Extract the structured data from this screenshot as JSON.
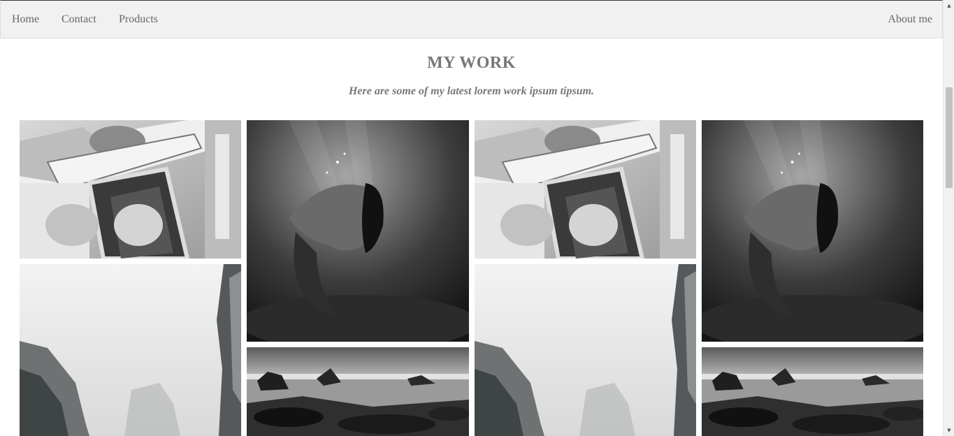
{
  "nav": {
    "home": "Home",
    "contact": "Contact",
    "products": "Products",
    "about": "About me"
  },
  "header": {
    "title": "MY WORK",
    "subtitle": "Here are some of my latest lorem work ipsum tipsum."
  },
  "gallery": {
    "photos": [
      {
        "subject": "couple-in-car"
      },
      {
        "subject": "underwater-woman"
      },
      {
        "subject": "misty-cliffs"
      },
      {
        "subject": "rocky-seashore"
      }
    ]
  },
  "colors": {
    "nav_bg": "#f1f1f1",
    "text": "#666666",
    "heading": "#777777"
  }
}
